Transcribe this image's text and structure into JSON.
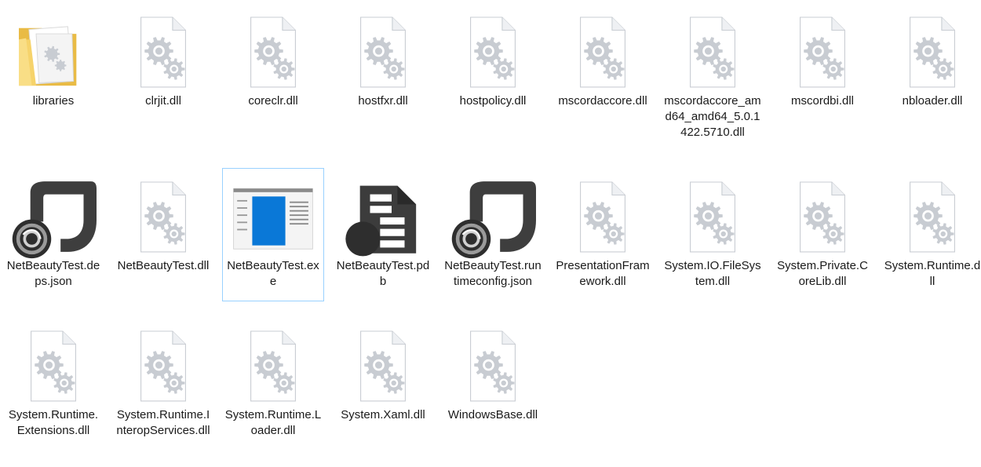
{
  "files": [
    {
      "name": "libraries",
      "icon": "folder-icon",
      "row": 0,
      "col": 0
    },
    {
      "name": "clrjit.dll",
      "icon": "dll-file-icon",
      "row": 0,
      "col": 1
    },
    {
      "name": "coreclr.dll",
      "icon": "dll-file-icon",
      "row": 0,
      "col": 2
    },
    {
      "name": "hostfxr.dll",
      "icon": "dll-file-icon",
      "row": 0,
      "col": 3
    },
    {
      "name": "hostpolicy.dll",
      "icon": "dll-file-icon",
      "row": 0,
      "col": 4
    },
    {
      "name": "mscordaccore.dll",
      "icon": "dll-file-icon",
      "row": 0,
      "col": 5
    },
    {
      "name": "mscordaccore_amd64_amd64_5.0.1422.5710.dll",
      "icon": "dll-file-icon",
      "row": 0,
      "col": 6
    },
    {
      "name": "mscordbi.dll",
      "icon": "dll-file-icon",
      "row": 0,
      "col": 7
    },
    {
      "name": "nbloader.dll",
      "icon": "dll-file-icon",
      "row": 0,
      "col": 8
    },
    {
      "name": "NetBeautyTest.deps.json",
      "icon": "json-file-icon",
      "row": 1,
      "col": 0
    },
    {
      "name": "NetBeautyTest.dll",
      "icon": "dll-file-icon",
      "row": 1,
      "col": 1
    },
    {
      "name": "NetBeautyTest.exe",
      "icon": "exe-file-icon",
      "row": 1,
      "col": 2,
      "selected": true
    },
    {
      "name": "NetBeautyTest.pdb",
      "icon": "pdb-file-icon",
      "row": 1,
      "col": 3
    },
    {
      "name": "NetBeautyTest.runtimeconfig.json",
      "icon": "json-file-icon",
      "row": 1,
      "col": 4
    },
    {
      "name": "PresentationFramework.dll",
      "icon": "dll-file-icon",
      "row": 1,
      "col": 5
    },
    {
      "name": "System.IO.FileSystem.dll",
      "icon": "dll-file-icon",
      "row": 1,
      "col": 6
    },
    {
      "name": "System.Private.CoreLib.dll",
      "icon": "dll-file-icon",
      "row": 1,
      "col": 7
    },
    {
      "name": "System.Runtime.dll",
      "icon": "dll-file-icon",
      "row": 1,
      "col": 8
    },
    {
      "name": "System.Runtime.Extensions.dll",
      "icon": "dll-file-icon",
      "row": 2,
      "col": 0
    },
    {
      "name": "System.Runtime.InteropServices.dll",
      "icon": "dll-file-icon",
      "row": 2,
      "col": 1
    },
    {
      "name": "System.Runtime.Loader.dll",
      "icon": "dll-file-icon",
      "row": 2,
      "col": 2
    },
    {
      "name": "System.Xaml.dll",
      "icon": "dll-file-icon",
      "row": 2,
      "col": 3
    },
    {
      "name": "WindowsBase.dll",
      "icon": "dll-file-icon",
      "row": 2,
      "col": 4
    }
  ],
  "colors": {
    "selection_border": "#99d1ff",
    "folder": "#f6d36b",
    "exe_accent": "#0a78d7",
    "json_dark": "#3c3c3c"
  }
}
